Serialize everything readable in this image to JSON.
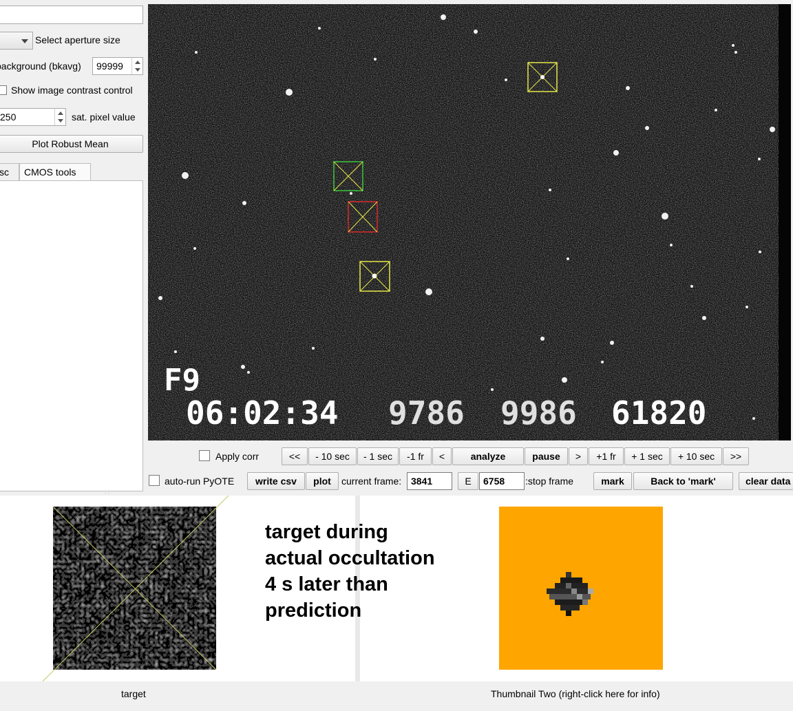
{
  "left_panel": {
    "aperture_label": "Select aperture size",
    "background_label": "background (bkavg)",
    "background_value": "99999",
    "contrast_checkbox_label": "Show image contrast control",
    "sat_value": "250",
    "sat_label": "sat. pixel value",
    "plot_robust_mean_label": "Plot Robust Mean",
    "tabs": [
      {
        "label": "sc"
      },
      {
        "label": "CMOS tools"
      }
    ]
  },
  "image": {
    "overlay_line1": "F9",
    "overlay_time": "06:02:34",
    "overlay_num1": "9786",
    "overlay_num2": "9986",
    "overlay_num3": "61820"
  },
  "controls": {
    "apply_corr_label": "Apply corr",
    "nav_buttons": [
      "<<",
      "- 10 sec",
      "- 1 sec",
      "-1 fr",
      "<",
      "analyze",
      "pause",
      ">",
      "+1 fr",
      "+ 1 sec",
      "+ 10 sec",
      ">>"
    ],
    "auto_run_label": "auto-run PyOTE",
    "write_csv_label": "write csv",
    "plot_label": "plot",
    "current_frame_label": "current frame:",
    "current_frame_value": "3841",
    "e_label": "E",
    "stop_frame_value": "6758",
    "stop_frame_label": ":stop frame",
    "mark_label": "mark",
    "back_to_mark_label": "Back to 'mark'",
    "clear_data_label": "clear data"
  },
  "bottom": {
    "note_lines": [
      "target during",
      "actual occultation",
      "4 s later than",
      "prediction"
    ],
    "caption_left": "target",
    "caption_right": "Thumbnail Two (right-click here for info)"
  },
  "colors": {
    "aperture_yellow": "#e8e84a",
    "aperture_green": "#3cc83c",
    "aperture_red": "#d82a2a",
    "thumbnail_orange": "#ffa500"
  }
}
